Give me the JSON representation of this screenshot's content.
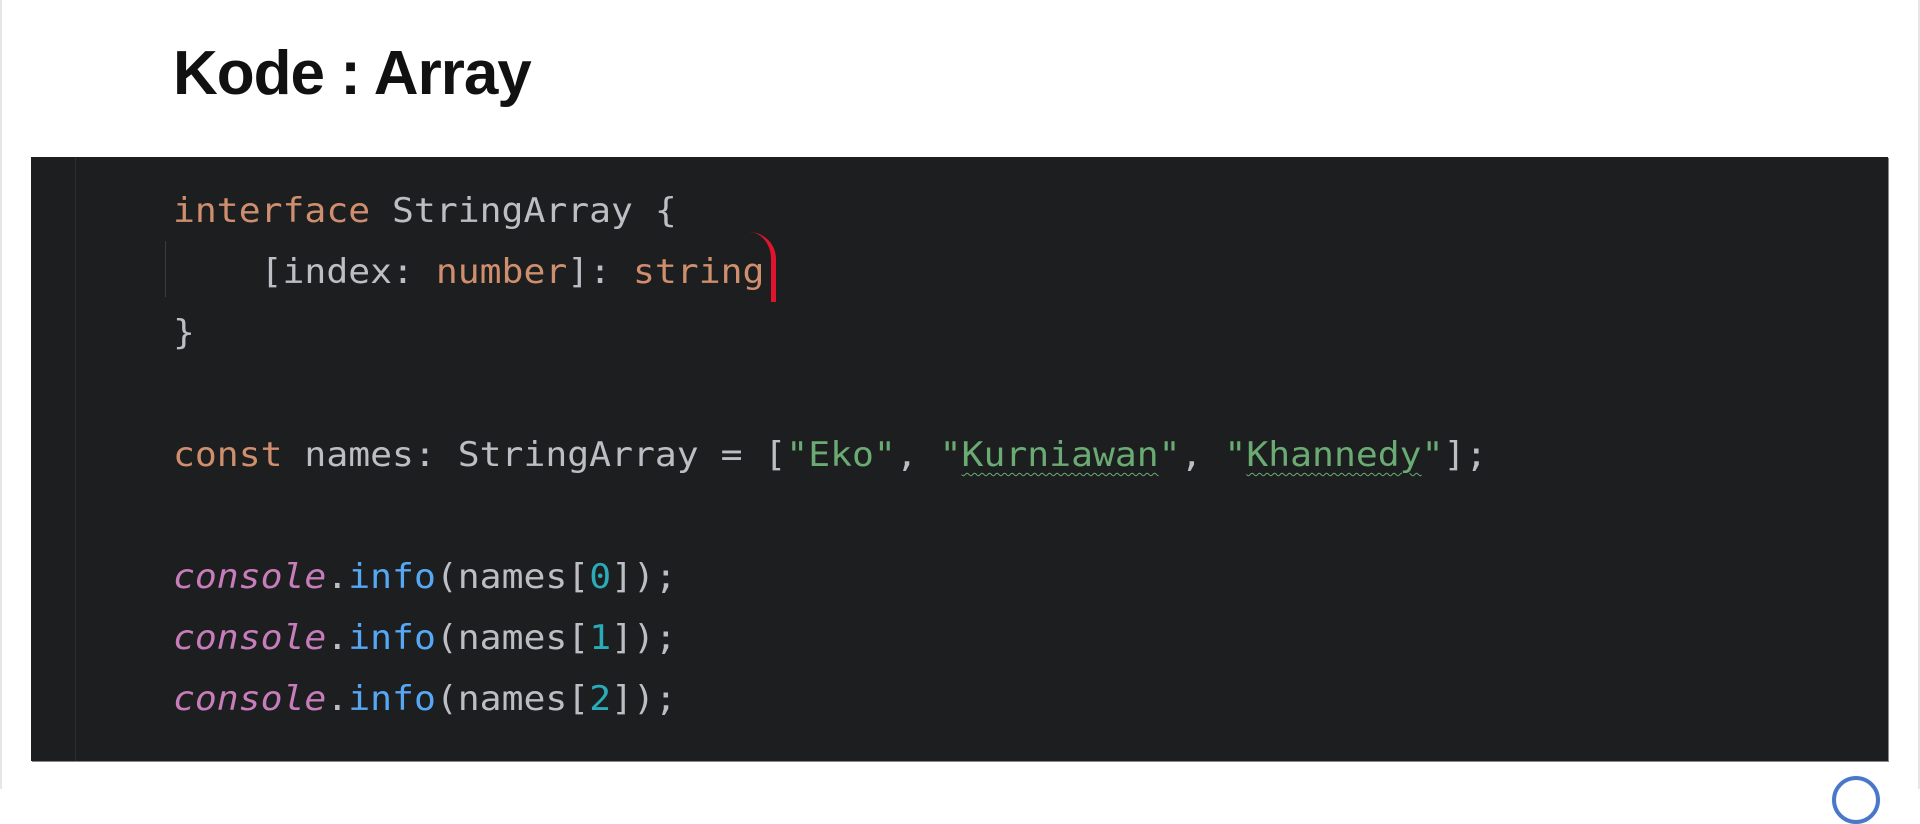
{
  "slide": {
    "title": "Kode : Array"
  },
  "code": {
    "line1": {
      "kw": "interface",
      "rest": " StringArray {"
    },
    "line2": {
      "a": "    [index: ",
      "kw1": "number",
      "b": "]: ",
      "kw2": "string"
    },
    "line3": "}",
    "line5": {
      "kw": "const",
      "a": " names: StringArray = [",
      "s1": "\"Eko\"",
      "c1": ", ",
      "q1": "\"",
      "s2": "Kurniawan",
      "q2": "\"",
      "c2": ", ",
      "q3": "\"",
      "s3": "Khannedy",
      "q4": "\"",
      "end": "];"
    },
    "console_lines": [
      {
        "obj": "console",
        "dot": ".",
        "fn": "info",
        "a": "(names[",
        "idx": "0",
        "b": "]);"
      },
      {
        "obj": "console",
        "dot": ".",
        "fn": "info",
        "a": "(names[",
        "idx": "1",
        "b": "]);"
      },
      {
        "obj": "console",
        "dot": ".",
        "fn": "info",
        "a": "(names[",
        "idx": "2",
        "b": "]);"
      }
    ]
  },
  "colors": {
    "background": "#1d1e1f",
    "keyword": "#cf8e6d",
    "string": "#6aab73",
    "function": "#56a8f5",
    "number": "#2aacb8",
    "italic_object": "#c77dbb"
  }
}
